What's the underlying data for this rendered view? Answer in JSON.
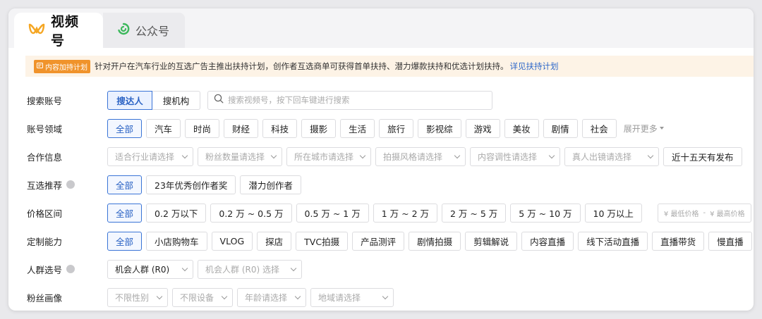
{
  "tabs": [
    {
      "label": "视频号",
      "active": true,
      "icon": "channels-logo-icon",
      "color": "#f5a623"
    },
    {
      "label": "公众号",
      "active": false,
      "icon": "official-account-icon",
      "color": "#3cb85c"
    }
  ],
  "notice": {
    "badge": "内容加持计划",
    "text": "针对开户在汽车行业的互选广告主推出扶持计划，创作者互选商单可获得首单扶持、潜力爆款扶持和优选计划扶持。",
    "link": "详见扶持计划"
  },
  "search_row": {
    "label": "搜索账号",
    "modes": [
      "搜达人",
      "搜机构"
    ],
    "placeholder": "搜索视频号，按下回车键进行搜索"
  },
  "domain_row": {
    "label": "账号领域",
    "options": [
      "全部",
      "汽车",
      "时尚",
      "财经",
      "科技",
      "摄影",
      "生活",
      "旅行",
      "影视综",
      "游戏",
      "美妆",
      "剧情",
      "社会"
    ],
    "expand": "展开更多"
  },
  "coop_row": {
    "label": "合作信息",
    "dropdowns": [
      "适合行业请选择",
      "粉丝数量请选择",
      "所在城市请选择",
      "拍摄风格请选择",
      "内容调性请选择",
      "真人出镜请选择"
    ],
    "extra": "近十五天有发布"
  },
  "recommend_row": {
    "label": "互选推荐",
    "options": [
      "全部",
      "23年优秀创作者奖",
      "潜力创作者"
    ]
  },
  "price_row": {
    "label": "价格区间",
    "options": [
      "全部",
      "0.2 万以下",
      "0.2 万 ~ 0.5 万",
      "0.5 万 ~ 1 万",
      "1 万 ~ 2 万",
      "2 万 ~ 5 万",
      "5 万 ~ 10 万",
      "10 万以上"
    ],
    "min_placeholder": "¥ 最低价格",
    "separator": "-",
    "max_placeholder": "¥ 最高价格"
  },
  "custom_row": {
    "label": "定制能力",
    "options": [
      "全部",
      "小店购物车",
      "VLOG",
      "探店",
      "TVC拍摄",
      "产品测评",
      "剧情拍摄",
      "剪辑解说",
      "内容直播",
      "线下活动直播",
      "直播带货",
      "慢直播"
    ]
  },
  "crowd_row": {
    "label": "人群选号",
    "selected": "机会人群 (R0)",
    "dropdown": "机会人群 (R0) 选择"
  },
  "fans_row": {
    "label": "粉丝画像",
    "dropdowns": [
      "不限性别",
      "不限设备",
      "年龄请选择",
      "地域请选择"
    ]
  },
  "colors": {
    "accent": "#3a74d6",
    "notice_bg": "#fdf3e6",
    "badge": "#f0932b",
    "link": "#2b66c9"
  }
}
